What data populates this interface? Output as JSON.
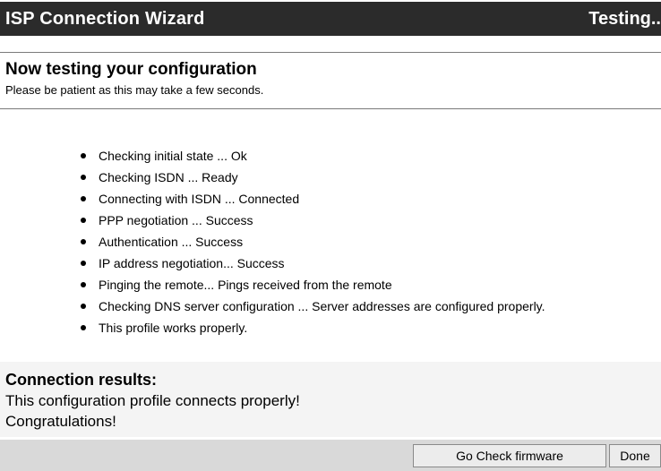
{
  "header": {
    "title": "ISP Connection Wizard",
    "status": "Testing.."
  },
  "intro": {
    "heading": "Now testing your configuration",
    "subheading": "Please be patient as this may take a few seconds."
  },
  "steps": [
    "Checking initial state ... Ok",
    "Checking ISDN ... Ready",
    "Connecting with ISDN ... Connected",
    "PPP negotiation ... Success",
    "Authentication ... Success",
    "IP address negotiation... Success",
    "Pinging the remote... Pings received from the remote",
    "Checking DNS server configuration ... Server addresses are configured properly.",
    "This profile works properly."
  ],
  "results": {
    "heading": "Connection results:",
    "line1": "This configuration profile connects properly!",
    "line2": "Congratulations!"
  },
  "footer": {
    "check_firmware_label": "Go Check firmware",
    "done_label": "Done"
  },
  "colors": {
    "titlebar_bg": "#2b2b2b",
    "results_bg": "#f4f4f4",
    "footer_bg": "#d9d9d9"
  }
}
